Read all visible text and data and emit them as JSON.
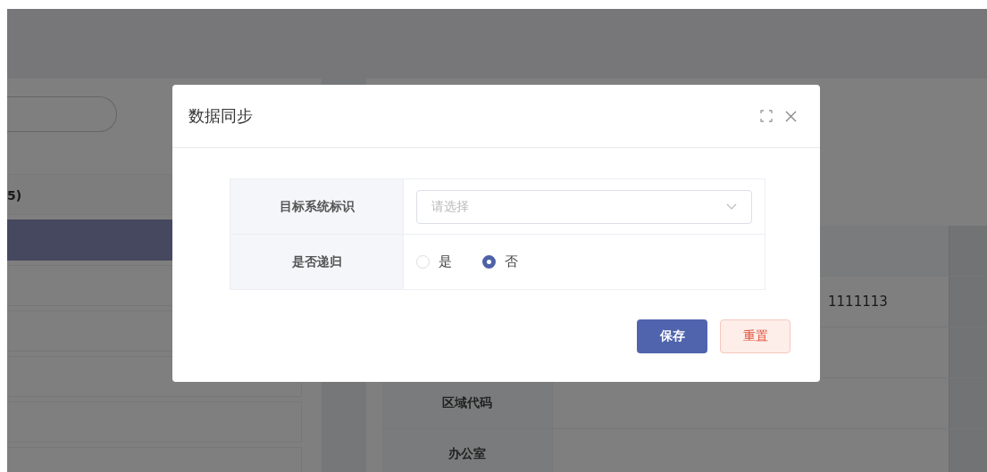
{
  "left_panel": {
    "items": [
      {
        "label": "5)",
        "selected": false
      },
      {
        "selected": true
      },
      {
        "selected": false
      },
      {
        "selected": false
      },
      {
        "selected": false
      },
      {
        "selected": false
      },
      {
        "selected": false
      }
    ]
  },
  "detail_table": {
    "rows": [
      {
        "value": "1111113"
      },
      {
        "label": "区域代码"
      },
      {
        "label": "办公室"
      }
    ]
  },
  "dialog": {
    "title": "数据同步",
    "fields": [
      {
        "kind": "select",
        "label": "目标系统标识",
        "placeholder": "请选择"
      },
      {
        "kind": "radio",
        "label": "是否递归",
        "options": [
          {
            "label": "是",
            "selected": false
          },
          {
            "label": "否",
            "selected": true
          }
        ]
      }
    ],
    "buttons": [
      {
        "label": "保存",
        "kind": "primary"
      },
      {
        "label": "重置",
        "kind": "danger"
      }
    ]
  }
}
